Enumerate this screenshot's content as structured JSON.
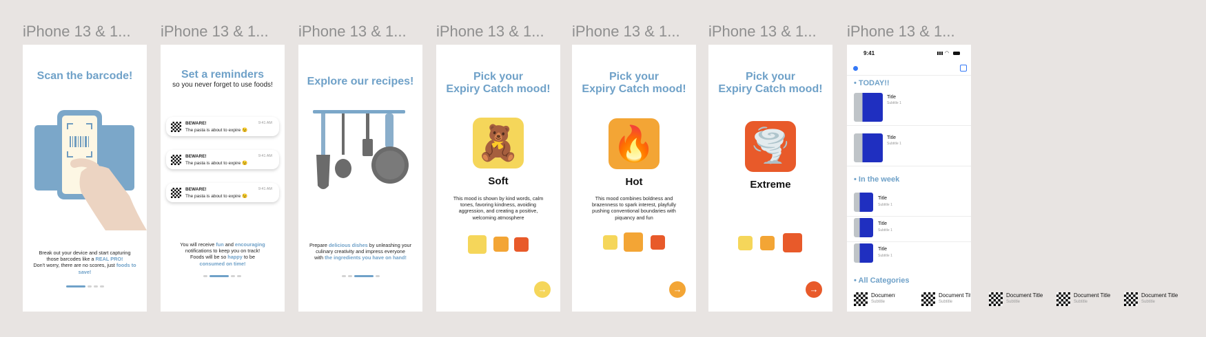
{
  "frame_labels": [
    "iPhone 13 & 1...",
    "iPhone 13 & 1...",
    "iPhone 13 & 1...",
    "iPhone 13 & 1...",
    "iPhone 13 & 1...",
    "iPhone 13 & 1...",
    "iPhone 13 & 1..."
  ],
  "screen1": {
    "title": "Scan the barcode!",
    "body_1": "Break out your device and start capturing",
    "body_2a": "those barcodes like a ",
    "body_2b": "REAL PRO!",
    "body_3a": "Don't worry, there are no scores, just ",
    "body_3b": "foods to save!"
  },
  "screen2": {
    "title": "Set a reminders",
    "subtitle": "so you never forget to use foods!",
    "notifications": [
      {
        "title": "BEWARE!",
        "message": "The pasta is about to expire 😉",
        "time": "9:41 AM"
      },
      {
        "title": "BEWARE!",
        "message": "The pasta is about to expire 😉",
        "time": "9:41 AM"
      },
      {
        "title": "BEWARE!",
        "message": "The pasta is about to expire 😉",
        "time": "9:41 AM"
      }
    ],
    "body_1a": "You will receive ",
    "body_1b": "fun",
    "body_1c": " and ",
    "body_1d": "encouraging",
    "body_2": "notifications to keep you on track!",
    "body_3a": "Foods will be so ",
    "body_3b": "happy",
    "body_3c": " to be",
    "body_4": "consumed on time!"
  },
  "screen3": {
    "title": "Explore our recipes!",
    "body_1a": "Prepare ",
    "body_1b": "delicious dishes",
    "body_1c": " by unleashing your",
    "body_2": "culinary creativity and impress everyone",
    "body_3a": "with ",
    "body_3b": "the ingredients you have on hand!"
  },
  "mood_title_1": "Pick your",
  "mood_title_2": "Expiry Catch mood!",
  "screen4": {
    "emoji": "🧸",
    "mood": "Soft",
    "description": "This mood is shown by kind words, calm tones, favoring kindness, avoiding aggression, and creating a positive, welcoming atmosphere"
  },
  "screen5": {
    "emoji": "🔥",
    "mood": "Hot",
    "description": "This mood combines boldness and brazenness to spark interest, playfully pushing conventional boundaries with piquancy and fun"
  },
  "screen6": {
    "emoji": "🌪️",
    "mood": "Extreme"
  },
  "next_arrow": "→",
  "screen7": {
    "status_time": "9:41",
    "today_header": "TODAY!!",
    "today_items": [
      {
        "title": "Title",
        "subtitle": "Subtitle 1"
      },
      {
        "title": "Title",
        "subtitle": "Subtitle 1"
      }
    ],
    "week_header": "In the week",
    "week_items": [
      {
        "title": "Title",
        "subtitle": "Subtitle 1"
      },
      {
        "title": "Title",
        "subtitle": "Subtitle 1"
      },
      {
        "title": "Title",
        "subtitle": "Subtitle 1"
      }
    ],
    "categories_header": "All Categories"
  },
  "documents": [
    {
      "title": "Document Title",
      "subtitle": "Subtitle"
    },
    {
      "title": "Document Title",
      "subtitle": "Subtitle"
    },
    {
      "title": "Document Title",
      "subtitle": "Subtitle"
    },
    {
      "title": "Document Title",
      "subtitle": "Subtitle"
    },
    {
      "title": "Document Title",
      "subtitle": "Subtitle"
    }
  ],
  "colors": {
    "background": "#e8e4e2",
    "accent_blue": "#6fa1c8",
    "yellow": "#f5d65a",
    "orange": "#f3a535",
    "red_orange": "#e85a2a"
  },
  "icons": [
    "phone-barcode-illustration",
    "checker-icon",
    "utensils-illustration",
    "teddy-bear-emoji",
    "fire-emoji",
    "tornado-emoji",
    "arrow-right-icon",
    "scan-icon",
    "signal-icon",
    "battery-icon"
  ]
}
